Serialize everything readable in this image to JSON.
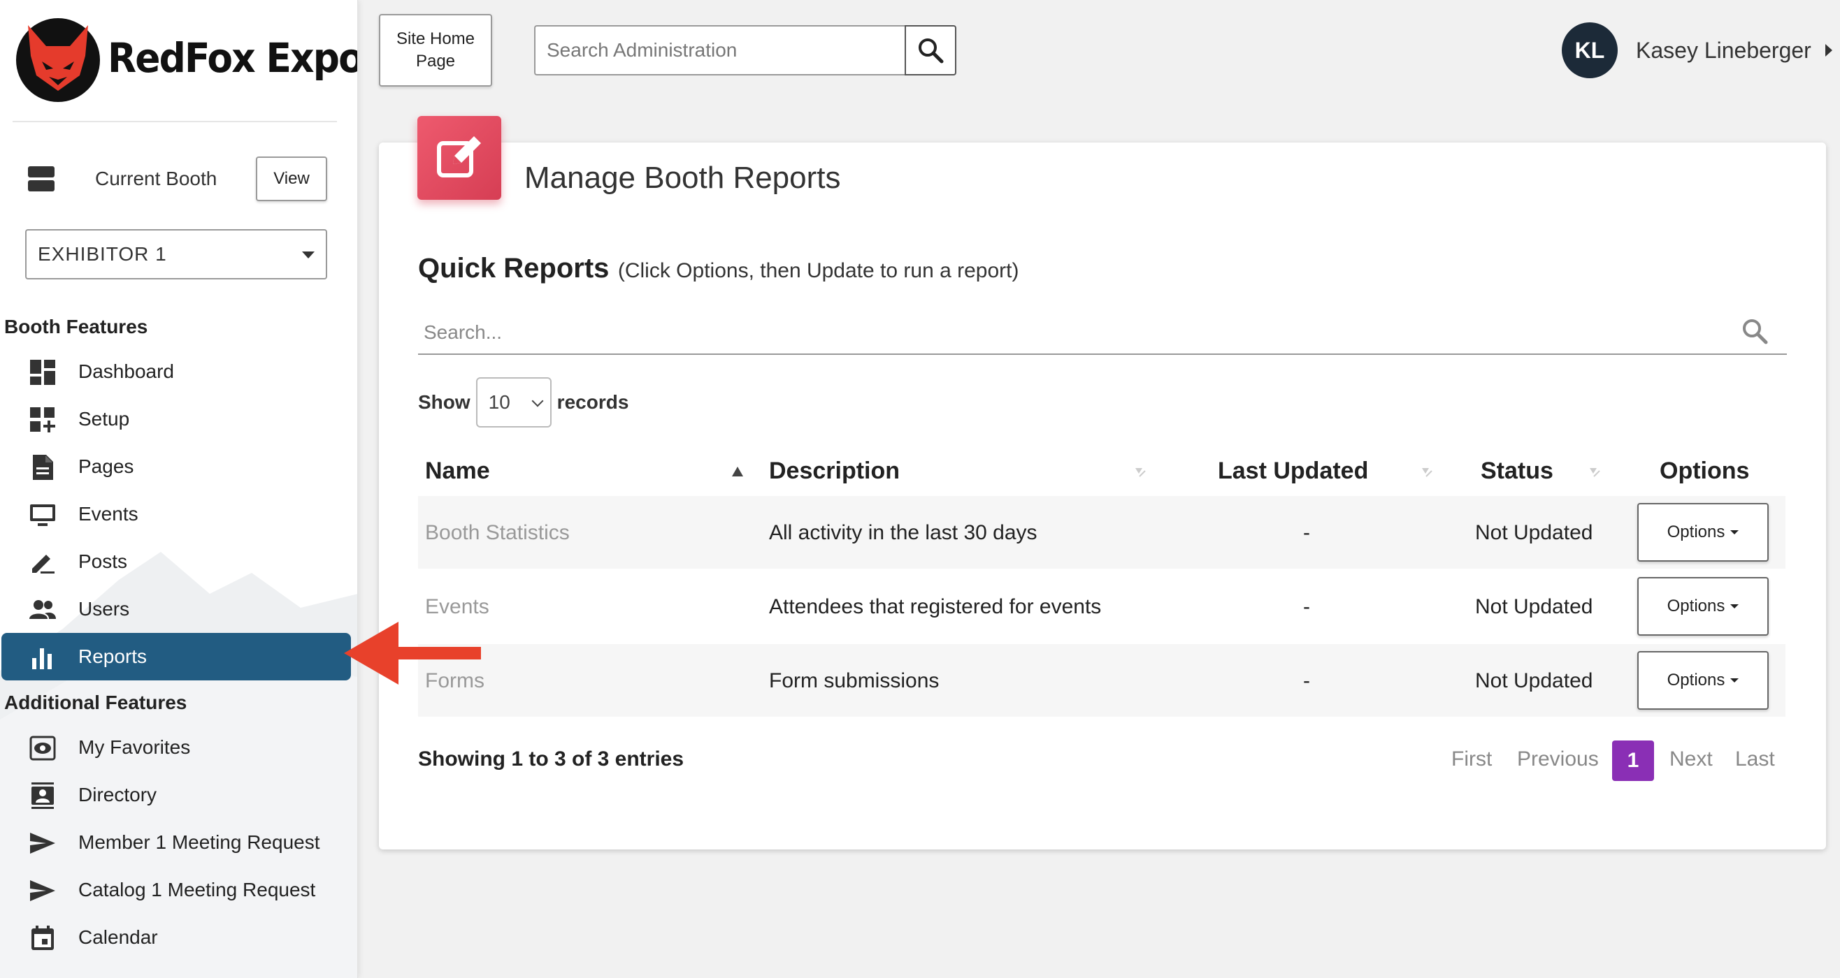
{
  "brand": {
    "name": "RedFox Expo"
  },
  "sidebar": {
    "current_booth_label": "Current Booth",
    "view_label": "View",
    "booth_select_value": "EXHIBITOR 1",
    "section_booth": "Booth Features",
    "booth_items": [
      {
        "label": "Dashboard",
        "icon": "dashboard-icon"
      },
      {
        "label": "Setup",
        "icon": "setup-icon"
      },
      {
        "label": "Pages",
        "icon": "pages-icon"
      },
      {
        "label": "Events",
        "icon": "events-icon"
      },
      {
        "label": "Posts",
        "icon": "posts-icon"
      },
      {
        "label": "Users",
        "icon": "users-icon"
      },
      {
        "label": "Reports",
        "icon": "reports-icon",
        "active": true
      }
    ],
    "section_additional": "Additional Features",
    "additional_items": [
      {
        "label": "My Favorites",
        "icon": "favorites-icon"
      },
      {
        "label": "Directory",
        "icon": "directory-icon"
      },
      {
        "label": "Member 1 Meeting Request",
        "icon": "send-icon"
      },
      {
        "label": "Catalog 1 Meeting Request",
        "icon": "send-icon"
      },
      {
        "label": "Calendar",
        "icon": "calendar-icon"
      }
    ]
  },
  "topbar": {
    "site_home_label": "Site Home Page",
    "search_placeholder": "Search Administration",
    "user_initials": "KL",
    "user_name": "Kasey Lineberger"
  },
  "main": {
    "title": "Manage Booth Reports",
    "quick_reports_title": "Quick Reports",
    "quick_reports_hint": "(Click Options, then Update to run a report)",
    "search_placeholder": "Search...",
    "show_label": "Show",
    "records_value": "10",
    "records_label": "records",
    "columns": [
      "Name",
      "Description",
      "Last Updated",
      "Status",
      "Options"
    ],
    "rows": [
      {
        "name": "Booth Statistics",
        "description": "All activity in the last 30 days",
        "last_updated": "-",
        "status": "Not Updated",
        "options": "Options"
      },
      {
        "name": "Events",
        "description": "Attendees that registered for events",
        "last_updated": "-",
        "status": "Not Updated",
        "options": "Options"
      },
      {
        "name": "Forms",
        "description": "Form submissions",
        "last_updated": "-",
        "status": "Not Updated",
        "options": "Options"
      }
    ],
    "showing_text": "Showing 1 to 3 of 3 entries",
    "pagination": {
      "first": "First",
      "previous": "Previous",
      "current": "1",
      "next": "Next",
      "last": "Last"
    }
  },
  "colors": {
    "active_nav": "#225c82",
    "accent_icon": "#e14b5f",
    "page_current": "#8a2fb5",
    "annotation_arrow": "#e8412b"
  }
}
